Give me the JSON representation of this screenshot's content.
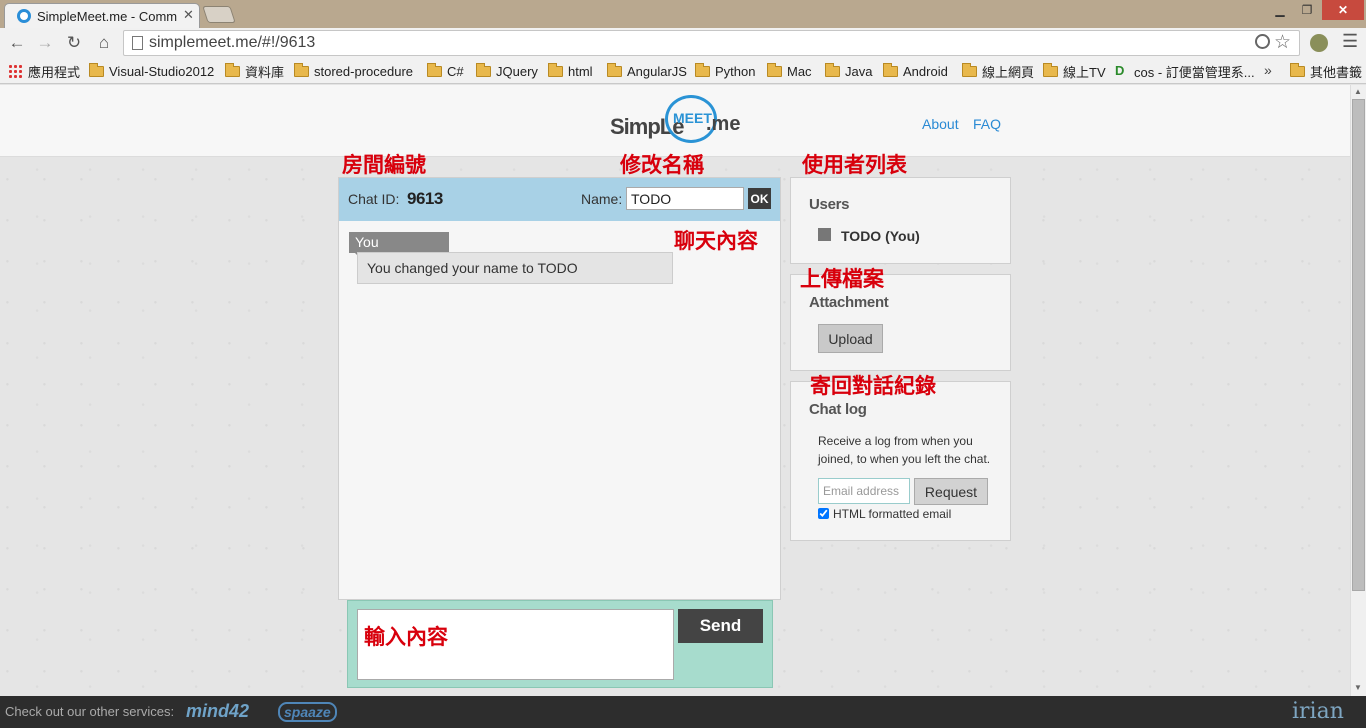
{
  "browser": {
    "tab_title": "SimpleMeet.me - Comm",
    "url": "simplemeet.me/#!/9613",
    "bookmarks": [
      "應用程式",
      "Visual-Studio2012",
      "資料庫",
      "stored-procedure",
      "C#",
      "JQuery",
      "html",
      "AngularJS",
      "Python",
      "Mac",
      "Java",
      "Android",
      "線上網頁",
      "線上TV",
      "cos - 訂便當管理系...",
      "其他書籤"
    ],
    "bookmarks_more": "»"
  },
  "header": {
    "logo_simple": "SimpLe",
    "logo_meet": "MEET",
    "logo_me": ".me",
    "nav": [
      "About",
      "FAQ"
    ]
  },
  "annotations": {
    "chat_id": "房間編號",
    "rename": "修改名稱",
    "user_list": "使用者列表",
    "chat_content": "聊天內容",
    "upload": "上傳檔案",
    "send_log": "寄回對話紀錄",
    "input": "輸入內容"
  },
  "chat": {
    "id_label": "Chat ID:",
    "id": "9613",
    "name_label": "Name:",
    "name_value": "TODO",
    "ok_label": "OK",
    "messages": [
      {
        "sender": "You",
        "text": "You changed your name to TODO"
      }
    ],
    "send_label": "Send"
  },
  "users": {
    "title": "Users",
    "list": [
      {
        "name": "TODO (You)",
        "color": "#777777"
      }
    ]
  },
  "attachment": {
    "title": "Attachment",
    "upload_label": "Upload"
  },
  "chat_log": {
    "title": "Chat log",
    "description": "Receive a log from when you joined, to when you left the chat.",
    "email_placeholder": "Email address",
    "request_label": "Request",
    "html_label": "HTML formatted email",
    "html_checked": true
  },
  "footer": {
    "text": "Check out our other services:",
    "services": [
      "mind42",
      "spaaze"
    ],
    "brand": "irian"
  },
  "colors": {
    "chat_bar": "#a8d1e6",
    "input_area": "#a7dccd",
    "link": "#2a8ad4",
    "annotation": "#d8000c"
  }
}
